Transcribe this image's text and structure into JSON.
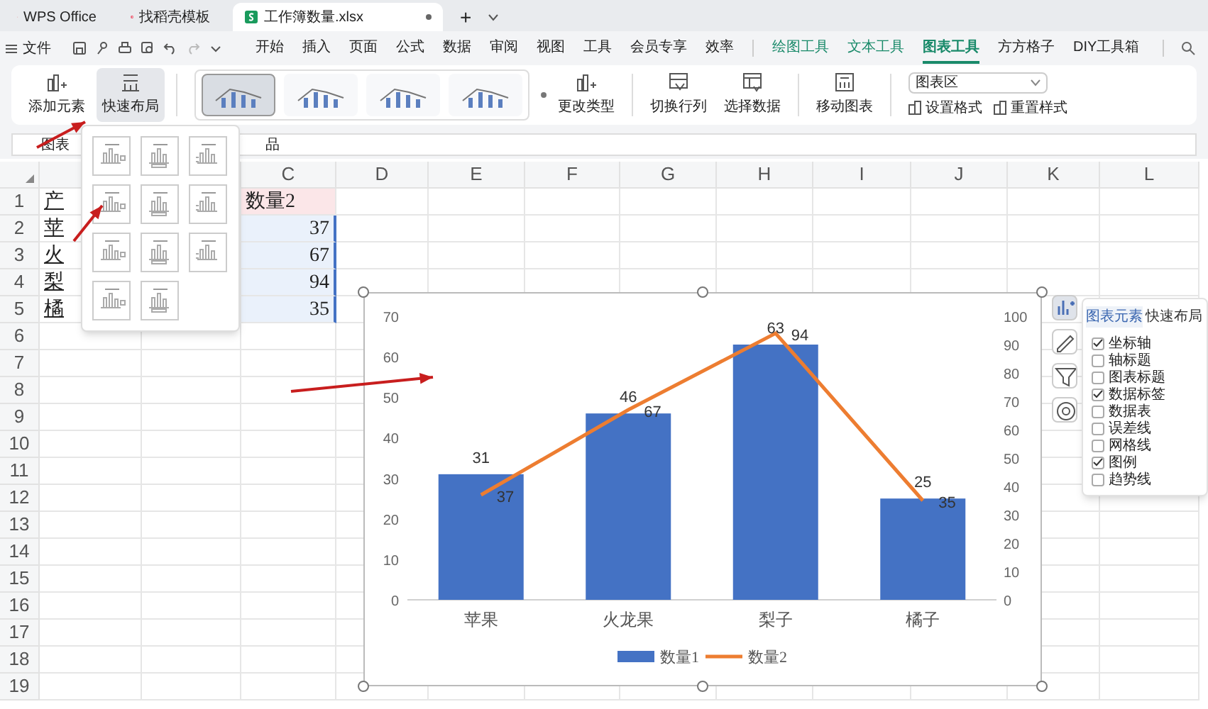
{
  "app_tabs": [
    {
      "label": "WPS Office",
      "kind": "home",
      "selected": false
    },
    {
      "label": "找稻壳模板",
      "kind": "template",
      "selected": false
    },
    {
      "label": "工作簿数量.xlsx",
      "kind": "sheet",
      "selected": true
    }
  ],
  "new_tab": "+",
  "menu": {
    "file": "文件",
    "items": [
      {
        "label": "开始",
        "kind": "main",
        "selected": false
      },
      {
        "label": "插入",
        "kind": "main",
        "selected": false
      },
      {
        "label": "页面",
        "kind": "main",
        "selected": false
      },
      {
        "label": "公式",
        "kind": "main",
        "selected": false
      },
      {
        "label": "数据",
        "kind": "main",
        "selected": false
      },
      {
        "label": "审阅",
        "kind": "main",
        "selected": false
      },
      {
        "label": "视图",
        "kind": "main",
        "selected": false
      },
      {
        "label": "工具",
        "kind": "main",
        "selected": false
      },
      {
        "label": "会员专享",
        "kind": "main",
        "selected": false
      },
      {
        "label": "效率",
        "kind": "main",
        "selected": false
      },
      {
        "label": "绘图工具",
        "kind": "context",
        "selected": false
      },
      {
        "label": "文本工具",
        "kind": "context",
        "selected": false
      },
      {
        "label": "图表工具",
        "kind": "context",
        "selected": true
      },
      {
        "label": "方方格子",
        "kind": "main",
        "selected": false
      },
      {
        "label": "DIY工具箱",
        "kind": "main",
        "selected": false
      }
    ]
  },
  "ribbon": {
    "add_element": "添加元素",
    "quick_layout": {
      "label": "快速布局",
      "selected": true
    },
    "styles": [
      {
        "selected": true
      },
      {
        "selected": false
      },
      {
        "selected": false
      },
      {
        "selected": false
      }
    ],
    "change_type": "更改类型",
    "switch_row_col": "切换行列",
    "select_data": "选择数据",
    "move_chart": "移动图表",
    "element_select": "图表区",
    "set_format": "设置格式",
    "reset_style": "重置样式"
  },
  "layout_popup": {
    "options": [
      {
        "selected": false
      },
      {
        "selected": false
      },
      {
        "selected": false
      },
      {
        "selected": false
      },
      {
        "selected": false
      },
      {
        "selected": false
      },
      {
        "selected": false
      },
      {
        "selected": false
      },
      {
        "selected": false
      },
      {
        "selected": false
      },
      {
        "selected": false
      }
    ]
  },
  "formula_bar": {
    "name_box": "图表",
    "formula": "品"
  },
  "sheet": {
    "columns": [
      "C",
      "D",
      "E",
      "F",
      "G",
      "H",
      "I",
      "J",
      "K",
      "L"
    ],
    "rows": [
      {
        "number": "1",
        "column_a": "产",
        "column_c": "数量2"
      },
      {
        "number": "2",
        "column_a": "苹",
        "column_c": "37"
      },
      {
        "number": "3",
        "column_a": "火",
        "column_c": "67"
      },
      {
        "number": "4",
        "column_a": "梨",
        "column_c": "94"
      },
      {
        "number": "5",
        "column_a": "橘",
        "column_c": "35"
      },
      {
        "number": "6"
      },
      {
        "number": "7"
      },
      {
        "number": "8"
      },
      {
        "number": "9"
      },
      {
        "number": "10"
      },
      {
        "number": "11"
      },
      {
        "number": "12"
      },
      {
        "number": "13"
      },
      {
        "number": "14"
      },
      {
        "number": "15"
      },
      {
        "number": "16"
      },
      {
        "number": "17"
      },
      {
        "number": "18"
      },
      {
        "number": "19"
      }
    ]
  },
  "chart": {
    "chart_data": {
      "type": "bar",
      "categories": [
        "苹果",
        "火龙果",
        "梨子",
        "橘子"
      ],
      "series": [
        {
          "name": "数量1",
          "type": "bar",
          "color": "#4472c4",
          "values": [
            31,
            46,
            63,
            25
          ]
        },
        {
          "name": "数量2",
          "type": "line",
          "color": "#ed7d31",
          "axis": "y2",
          "values": [
            37,
            67,
            94,
            35
          ]
        }
      ],
      "ylim": [
        0,
        70
      ],
      "yticks": [
        0,
        10,
        20,
        30,
        40,
        50,
        60,
        70
      ],
      "y2lim": [
        0,
        100
      ],
      "y2ticks": [
        0,
        10,
        20,
        30,
        40,
        50,
        60,
        70,
        80,
        90,
        100
      ],
      "data_labels": true,
      "legend": "bottom"
    }
  },
  "chart_panel": {
    "tabs": [
      {
        "label": "图表元素",
        "selected": true
      },
      {
        "label": "快速布局",
        "selected": false
      }
    ],
    "options": [
      {
        "label": "坐标轴",
        "checked": true
      },
      {
        "label": "轴标题",
        "checked": false
      },
      {
        "label": "图表标题",
        "checked": false
      },
      {
        "label": "数据标签",
        "checked": true
      },
      {
        "label": "数据表",
        "checked": false
      },
      {
        "label": "误差线",
        "checked": false
      },
      {
        "label": "网格线",
        "checked": false
      },
      {
        "label": "图例",
        "checked": true
      },
      {
        "label": "趋势线",
        "checked": false
      }
    ]
  }
}
